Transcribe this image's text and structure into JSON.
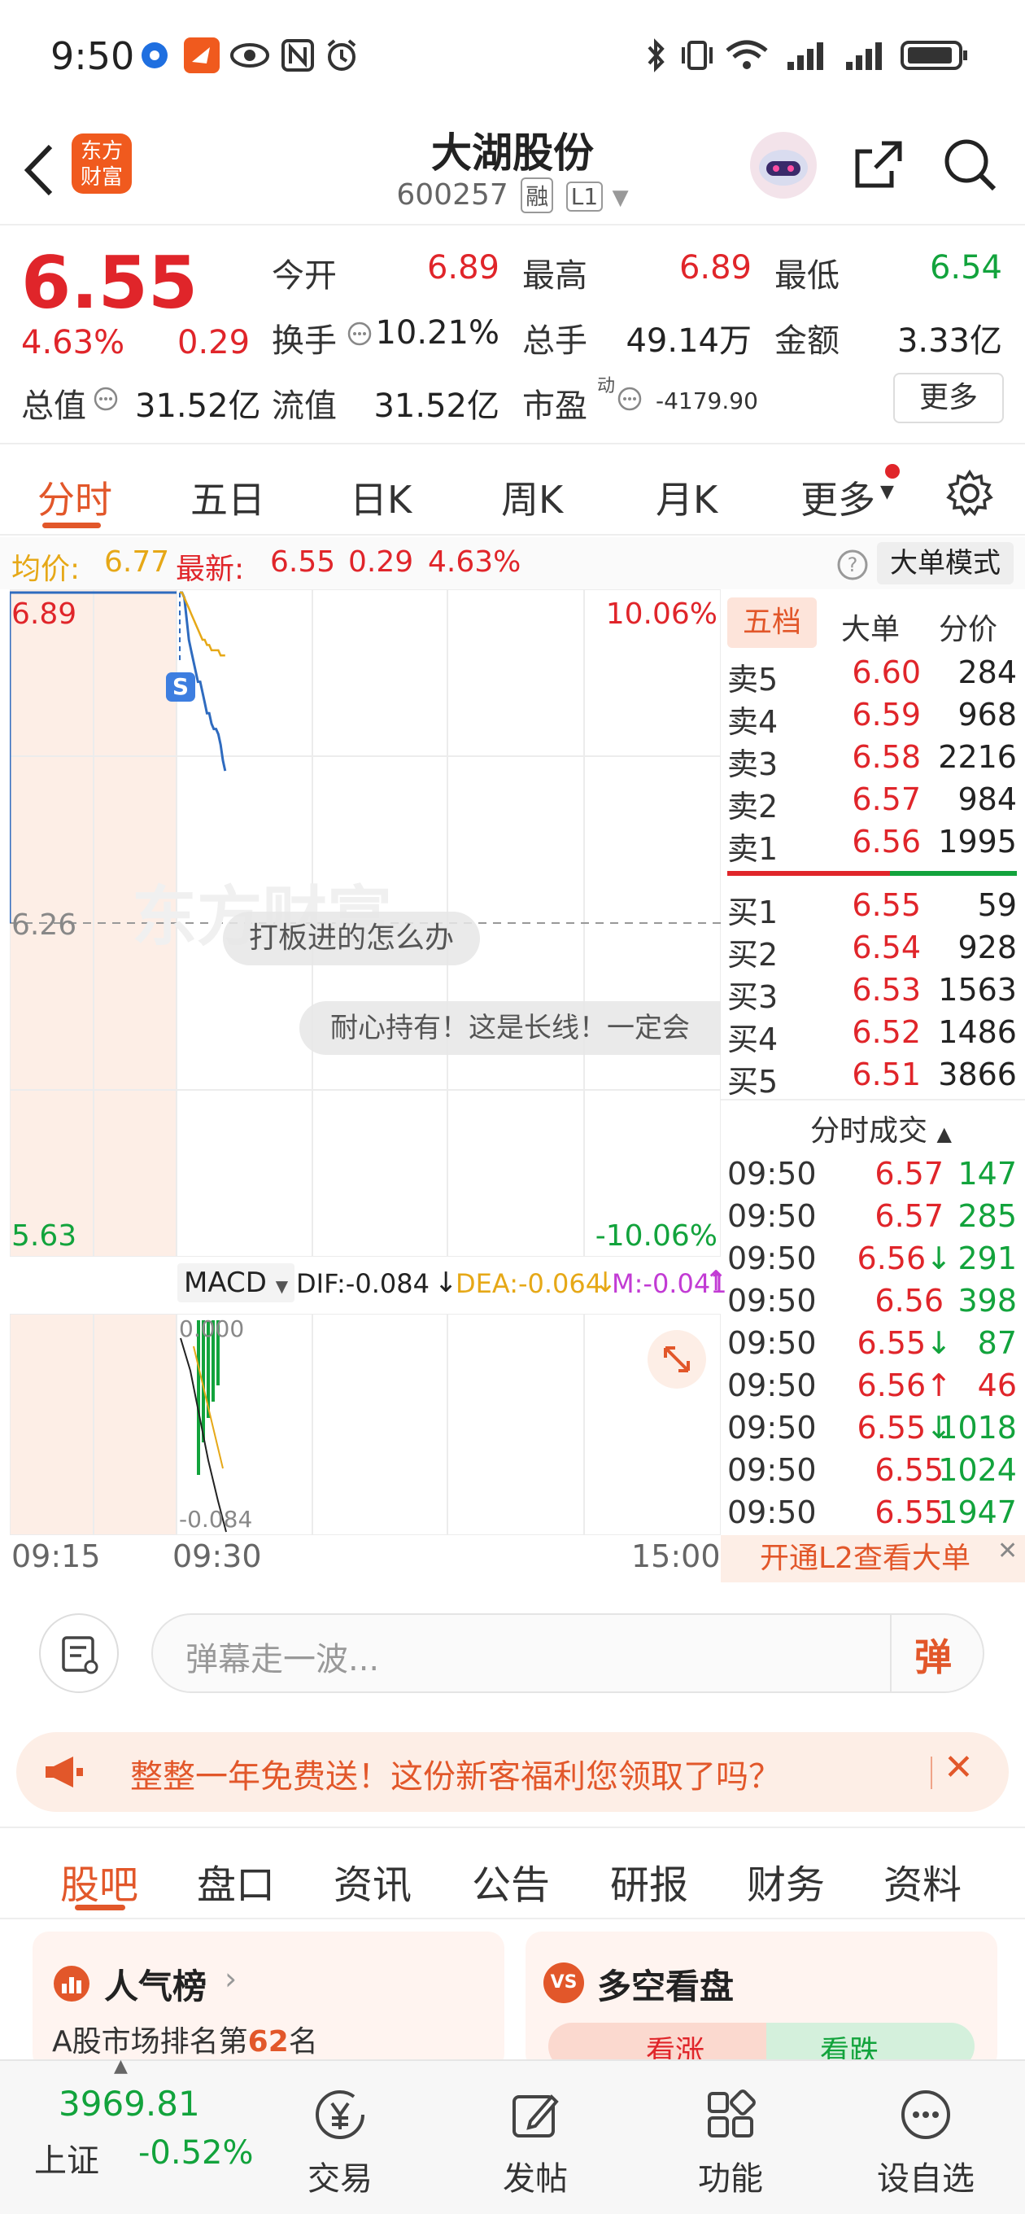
{
  "status_bar": {
    "time": "9:50"
  },
  "header": {
    "logo_text_1": "东方",
    "logo_text_2": "财富",
    "title": "大湖股份",
    "code": "600257",
    "tag_margin": "融",
    "tag_level": "L1"
  },
  "quote": {
    "price": "6.55",
    "change_pct": "4.63%",
    "change": "0.29",
    "open_label": "今开",
    "open": "6.89",
    "high_label": "最高",
    "high": "6.89",
    "low_label": "最低",
    "low": "6.54",
    "turnover_label": "换手",
    "turnover": "10.21%",
    "volume_label": "总手",
    "volume": "49.14万",
    "amount_label": "金额",
    "amount": "3.33亿",
    "mktcap_label": "总值",
    "mktcap": "31.52亿",
    "float_label": "流值",
    "float": "31.52亿",
    "pe_label": "市盈",
    "pe_sup": "动",
    "pe": "-4179.90",
    "more_button": "更多"
  },
  "chart_tabs": [
    "分时",
    "五日",
    "日K",
    "周K",
    "月K",
    "更多"
  ],
  "info_line": {
    "avg_label": "均价:",
    "avg": "6.77",
    "latest_label": "最新:",
    "latest": "6.55",
    "latest_change": "0.29",
    "latest_pct": "4.63%",
    "big_order_mode": "大单模式"
  },
  "chart": {
    "price_top": "6.89",
    "price_mid": "6.26",
    "price_bottom": "5.63",
    "pct_top": "10.06%",
    "pct_bottom": "-10.06%",
    "watermark": "东方财富",
    "danmaku_1": "打板进的怎么办",
    "danmaku_2": "耐心持有！这是长线！一定会",
    "s_marker": "S",
    "macd_select": "MACD",
    "dif": "DIF:-0.084",
    "dea": "DEA:-0.064",
    "m": "M:-0.041",
    "macd_top": "0.000",
    "macd_bottom": "-0.084",
    "time_start": "09:15",
    "time_mid": "09:30",
    "time_end": "15:00"
  },
  "chart_data": {
    "type": "line",
    "x": [
      "09:30",
      "09:31",
      "09:32",
      "09:33",
      "09:34",
      "09:35",
      "09:36",
      "09:37",
      "09:38",
      "09:39",
      "09:40",
      "09:41",
      "09:42",
      "09:43",
      "09:44",
      "09:45",
      "09:46",
      "09:47",
      "09:48",
      "09:49",
      "09:50"
    ],
    "series": [
      {
        "values": [
          6.89,
          6.89,
          6.88,
          6.84,
          6.8,
          6.78,
          6.76,
          6.74,
          6.72,
          6.72,
          6.7,
          6.68,
          6.66,
          6.66,
          6.64,
          6.63,
          6.63,
          6.62,
          6.6,
          6.57,
          6.55
        ]
      },
      {
        "values": [
          6.89,
          6.89,
          6.88,
          6.87,
          6.86,
          6.85,
          6.84,
          6.83,
          6.82,
          6.81,
          6.8,
          6.8,
          6.79,
          6.79,
          6.78,
          6.78,
          6.78,
          6.78,
          6.77,
          6.77,
          6.77
        ]
      }
    ],
    "ylim": [
      5.63,
      6.89
    ]
  },
  "orderbook": {
    "tabs": [
      "五档",
      "大单",
      "分价"
    ],
    "asks": [
      {
        "label": "卖5",
        "price": "6.60",
        "vol": "284"
      },
      {
        "label": "卖4",
        "price": "6.59",
        "vol": "968"
      },
      {
        "label": "卖3",
        "price": "6.58",
        "vol": "2216"
      },
      {
        "label": "卖2",
        "price": "6.57",
        "vol": "984"
      },
      {
        "label": "卖1",
        "price": "6.56",
        "vol": "1995"
      }
    ],
    "bids": [
      {
        "label": "买1",
        "price": "6.55",
        "vol": "59"
      },
      {
        "label": "买2",
        "price": "6.54",
        "vol": "928"
      },
      {
        "label": "买3",
        "price": "6.53",
        "vol": "1563"
      },
      {
        "label": "买4",
        "price": "6.52",
        "vol": "1486"
      },
      {
        "label": "买5",
        "price": "6.51",
        "vol": "3866"
      }
    ],
    "trades_title": "分时成交",
    "trades": [
      {
        "time": "09:50",
        "price": "6.57",
        "arrow": "",
        "vol": "147",
        "dir": "up"
      },
      {
        "time": "09:50",
        "price": "6.57",
        "arrow": "",
        "vol": "285",
        "dir": "up"
      },
      {
        "time": "09:50",
        "price": "6.56",
        "arrow": "↓",
        "vol": "291",
        "dir": "down"
      },
      {
        "time": "09:50",
        "price": "6.56",
        "arrow": "",
        "vol": "398",
        "dir": "down"
      },
      {
        "time": "09:50",
        "price": "6.55",
        "arrow": "↓",
        "vol": "87",
        "dir": "down"
      },
      {
        "time": "09:50",
        "price": "6.56",
        "arrow": "↑",
        "vol": "46",
        "dir": "up"
      },
      {
        "time": "09:50",
        "price": "6.55",
        "arrow": "↓",
        "vol": "1018",
        "dir": "down"
      },
      {
        "time": "09:50",
        "price": "6.55",
        "arrow": "",
        "vol": "1024",
        "dir": "down"
      },
      {
        "time": "09:50",
        "price": "6.55",
        "arrow": "",
        "vol": "1947",
        "dir": "down"
      }
    ],
    "l2_banner": "开通L2查看大单"
  },
  "danmaku_bar": {
    "placeholder": "弹幕走一波...",
    "send_label": "弹"
  },
  "promo": {
    "text": "整整一年免费送！这份新客福利您领取了吗？"
  },
  "feature_tabs": [
    "股吧",
    "盘口",
    "资讯",
    "公告",
    "研报",
    "财务",
    "资料"
  ],
  "cards": {
    "hot_title": "人气榜",
    "hot_rank_prefix": "A股市场排名第",
    "hot_rank": "62",
    "hot_rank_suffix": "名",
    "vs_badge": "VS",
    "vs_title": "多空看盘",
    "bull": "看涨",
    "bear": "看跌"
  },
  "bottom_nav": {
    "index_value": "3969.81",
    "index_name": "上证",
    "index_change": "-0.52%",
    "items": [
      "交易",
      "发帖",
      "功能",
      "设自选"
    ]
  },
  "colors": {
    "accent": "#e2572a",
    "up": "#e0252a",
    "down": "#12a33c",
    "avg_line": "#e6a817",
    "price_line": "#2f6bbf"
  }
}
